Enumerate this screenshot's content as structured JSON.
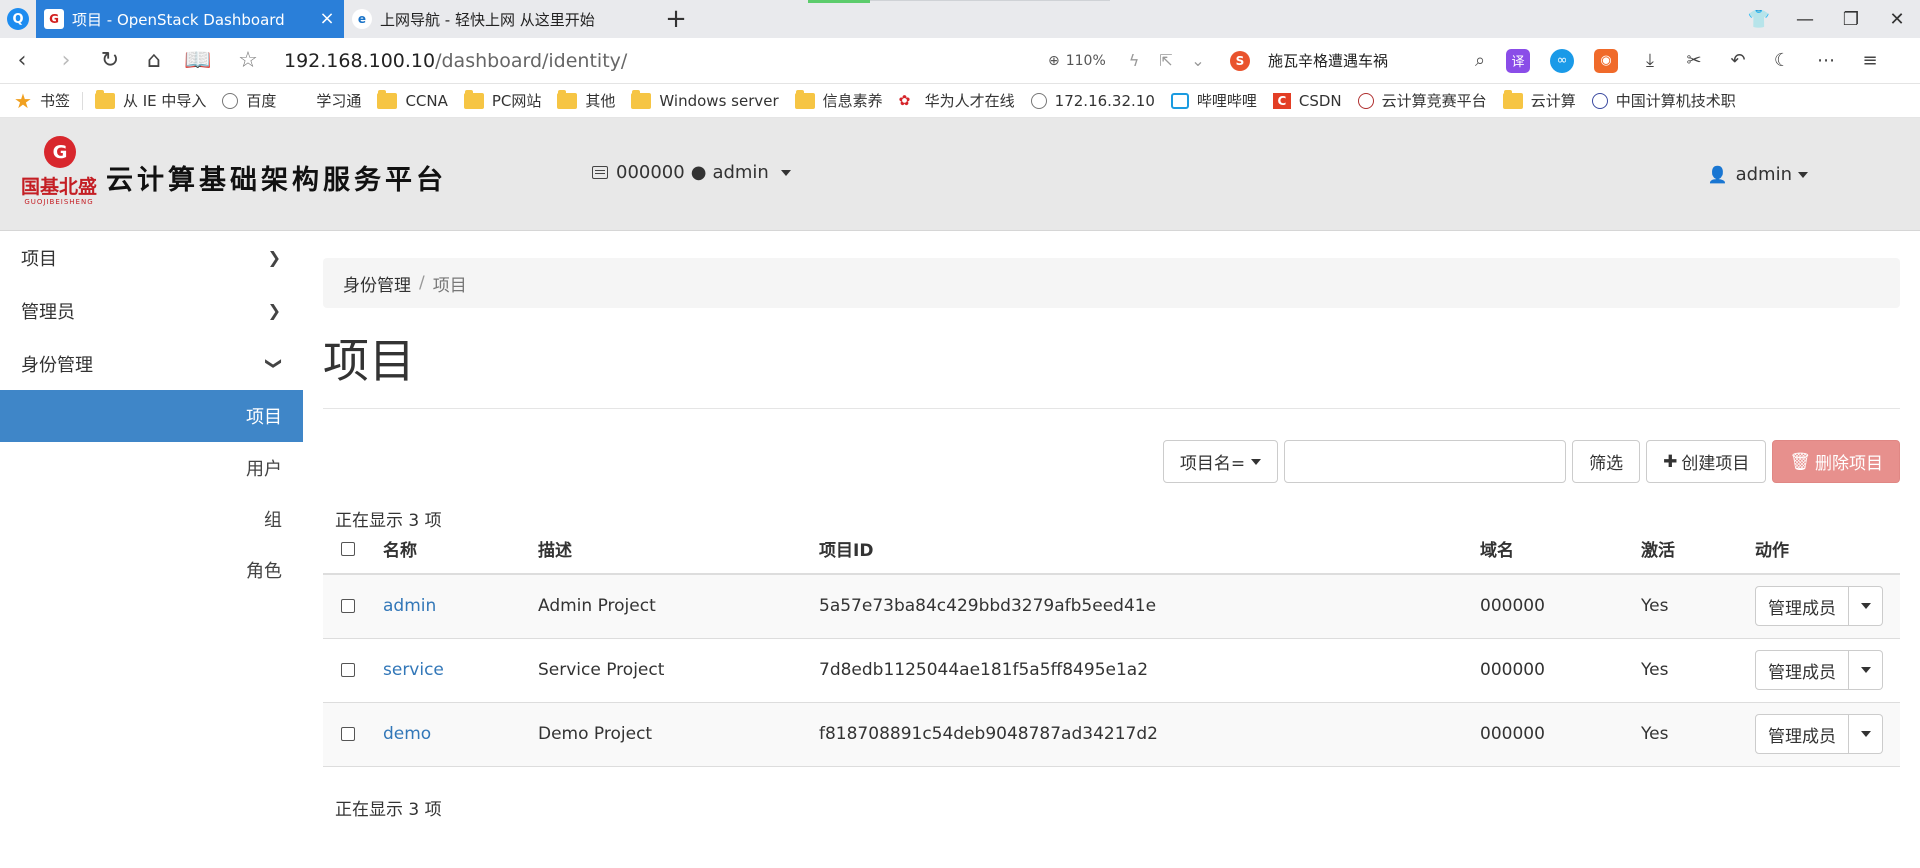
{
  "browser": {
    "tabs": [
      {
        "title": "项目 - OpenStack Dashboard",
        "active": true
      },
      {
        "title": "上网导航 - 轻快上网 从这里开始",
        "active": false
      }
    ],
    "url_host": "192.168.100.10",
    "url_path": "/dashboard/identity/",
    "zoom": "110%",
    "search_text": "施瓦辛格遭遇车祸",
    "bookmarks": [
      "书签",
      "从 IE 中导入",
      "百度",
      "学习通",
      "CCNA",
      "PC网站",
      "其他",
      "Windows server",
      "信息素养",
      "华为人才在线",
      "172.16.32.10",
      "哔哩哔哩",
      "CSDN",
      "云计算竞赛平台",
      "云计算",
      "中国计算机技术职"
    ]
  },
  "header": {
    "logo_cn": "国基北盛",
    "logo_en": "GUOJIBEISHENG",
    "site_title": "云计算基础架构服务平台",
    "project_domain": "000000",
    "project_user": "admin",
    "user": "admin"
  },
  "sidebar": {
    "groups": [
      {
        "label": "项目"
      },
      {
        "label": "管理员"
      },
      {
        "label": "身份管理"
      }
    ],
    "items": [
      {
        "label": "项目",
        "active": true
      },
      {
        "label": "用户"
      },
      {
        "label": "组"
      },
      {
        "label": "角色"
      }
    ]
  },
  "main": {
    "breadcrumb": [
      "身份管理",
      "项目"
    ],
    "title": "项目",
    "filter_select": "项目名=",
    "filter_value": "",
    "filter_button": "筛选",
    "create_button": "创建项目",
    "delete_button": "删除项目",
    "count_text": "正在显示 3 项",
    "columns": [
      "名称",
      "描述",
      "项目ID",
      "域名",
      "激活",
      "动作"
    ],
    "rows": [
      {
        "name": "admin",
        "description": "Admin Project",
        "id": "5a57e73ba84c429bbd3279afb5eed41e",
        "domain": "000000",
        "enabled": "Yes",
        "action": "管理成员"
      },
      {
        "name": "service",
        "description": "Service Project",
        "id": "7d8edb1125044ae181f5a5ff8495e1a2",
        "domain": "000000",
        "enabled": "Yes",
        "action": "管理成员"
      },
      {
        "name": "demo",
        "description": "Demo Project",
        "id": "f818708891c54deb9048787ad34217d2",
        "domain": "000000",
        "enabled": "Yes",
        "action": "管理成员"
      }
    ]
  },
  "colors": {
    "active_tab": "#2a7fd9",
    "sidebar_active": "#3f86c8",
    "link": "#3277b8",
    "danger_button": "#e7908d",
    "header_bg": "#e8e8e8"
  }
}
